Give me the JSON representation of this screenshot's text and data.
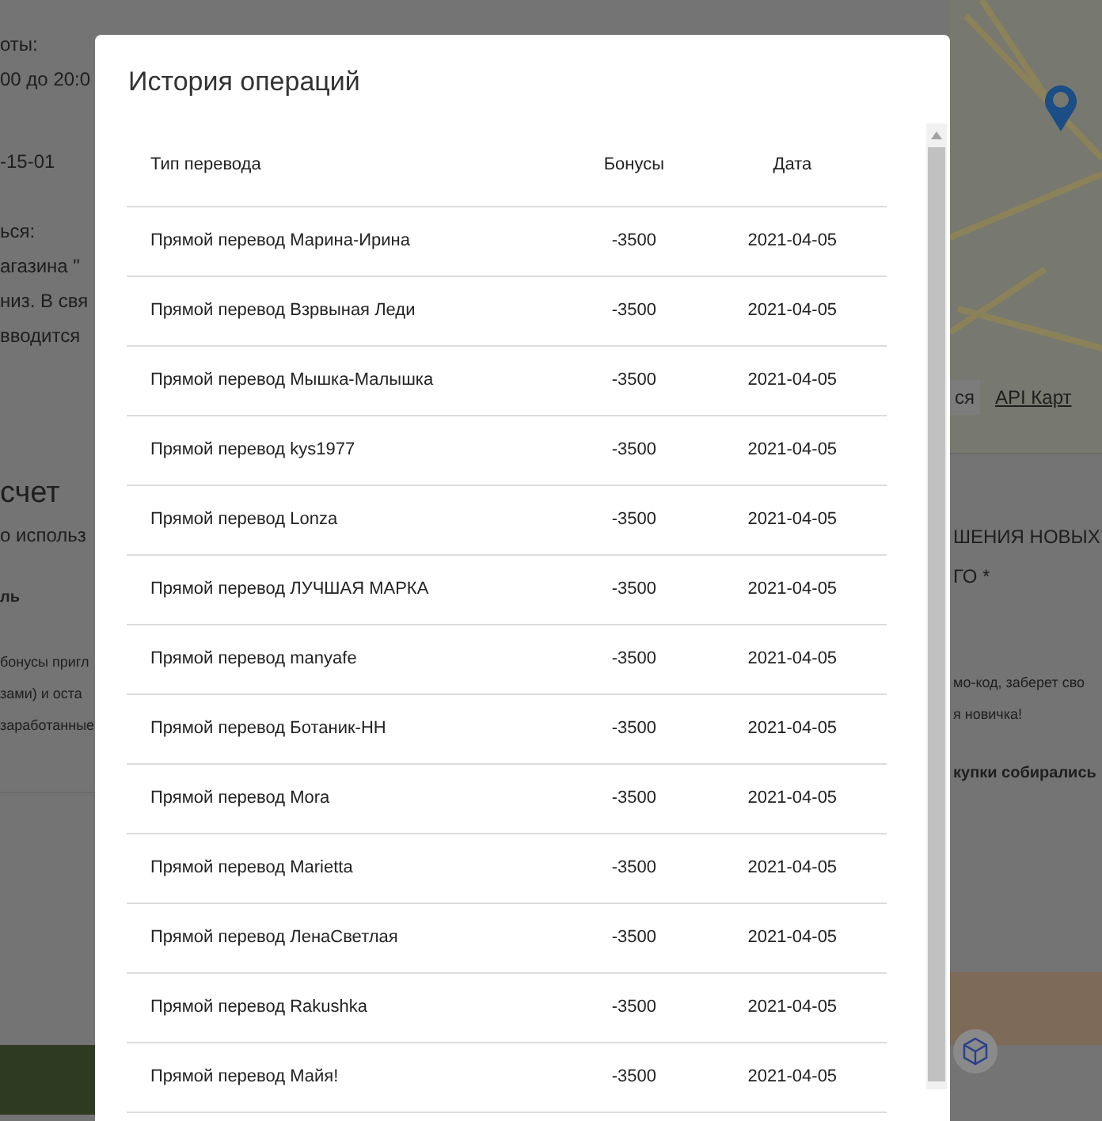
{
  "background": {
    "left_texts": [
      {
        "text": "оты:",
        "kind": "label"
      },
      {
        "text": "00 до 20:0",
        "kind": "value"
      },
      {
        "text": "-15-01",
        "kind": "value"
      },
      {
        "text": "ься:",
        "kind": "label"
      },
      {
        "text": "агазина \"",
        "kind": "value"
      },
      {
        "text": "низ. В свя",
        "kind": "value"
      },
      {
        "text": "вводится",
        "kind": "value"
      },
      {
        "text": "счет",
        "kind": "heading"
      },
      {
        "text": "о использ",
        "kind": "value"
      },
      {
        "text": "ль",
        "kind": "bold"
      },
      {
        "text": "бонусы пригл",
        "kind": "small"
      },
      {
        "text": "зами) и оста",
        "kind": "small"
      },
      {
        "text": "заработанные",
        "kind": "small"
      }
    ],
    "map_links": [
      "ся",
      "API Карт"
    ],
    "right_texts": [
      {
        "text": "ШЕНИЯ НОВЫХ",
        "kind": "value"
      },
      {
        "text": "ГО *",
        "kind": "value"
      },
      {
        "text": "мо-код, заберет сво",
        "kind": "small"
      },
      {
        "text": "я новичка!",
        "kind": "small"
      },
      {
        "text": "купки собирались",
        "kind": "bold"
      }
    ]
  },
  "modal": {
    "title": "История операций",
    "columns": [
      "Тип перевода",
      "Бонусы",
      "Дата"
    ],
    "rows": [
      [
        "Прямой перевод Марина-Ирина",
        "-3500",
        "2021-04-05"
      ],
      [
        "Прямой перевод Взрвыная Леди",
        "-3500",
        "2021-04-05"
      ],
      [
        "Прямой перевод Мышка-Малышка",
        "-3500",
        "2021-04-05"
      ],
      [
        "Прямой перевод kys1977",
        "-3500",
        "2021-04-05"
      ],
      [
        "Прямой перевод Lonza",
        "-3500",
        "2021-04-05"
      ],
      [
        "Прямой перевод ЛУЧШАЯ МАРКА",
        "-3500",
        "2021-04-05"
      ],
      [
        "Прямой перевод manyafe",
        "-3500",
        "2021-04-05"
      ],
      [
        "Прямой перевод Ботаник-НН",
        "-3500",
        "2021-04-05"
      ],
      [
        "Прямой перевод Mora",
        "-3500",
        "2021-04-05"
      ],
      [
        "Прямой перевод Marietta",
        "-3500",
        "2021-04-05"
      ],
      [
        "Прямой перевод ЛенаСветлая",
        "-3500",
        "2021-04-05"
      ],
      [
        "Прямой перевод Rakushka",
        "-3500",
        "2021-04-05"
      ],
      [
        "Прямой перевод Майя!",
        "-3500",
        "2021-04-05"
      ]
    ]
  }
}
